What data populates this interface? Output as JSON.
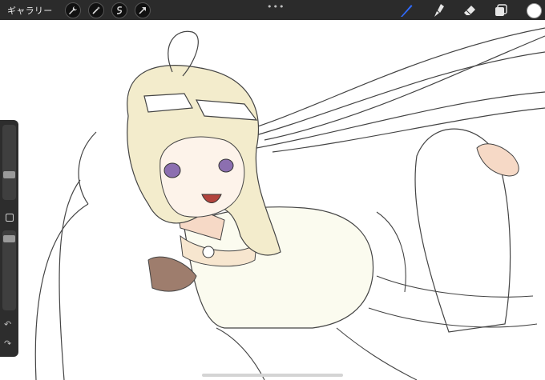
{
  "toolbar": {
    "gallery_label": "ギャラリー",
    "left_tools": [
      "wrench-icon",
      "magic-wand-icon",
      "selection-icon",
      "move-arrow-icon"
    ],
    "more_dots": "•••",
    "right_tools": [
      "brush-icon",
      "smudge-icon",
      "eraser-icon",
      "layers-icon"
    ],
    "active_brush_color": "#2f6bff",
    "current_color": "#ffffff"
  },
  "sidebar": {
    "undo_label": "↶",
    "redo_label": "↷"
  }
}
